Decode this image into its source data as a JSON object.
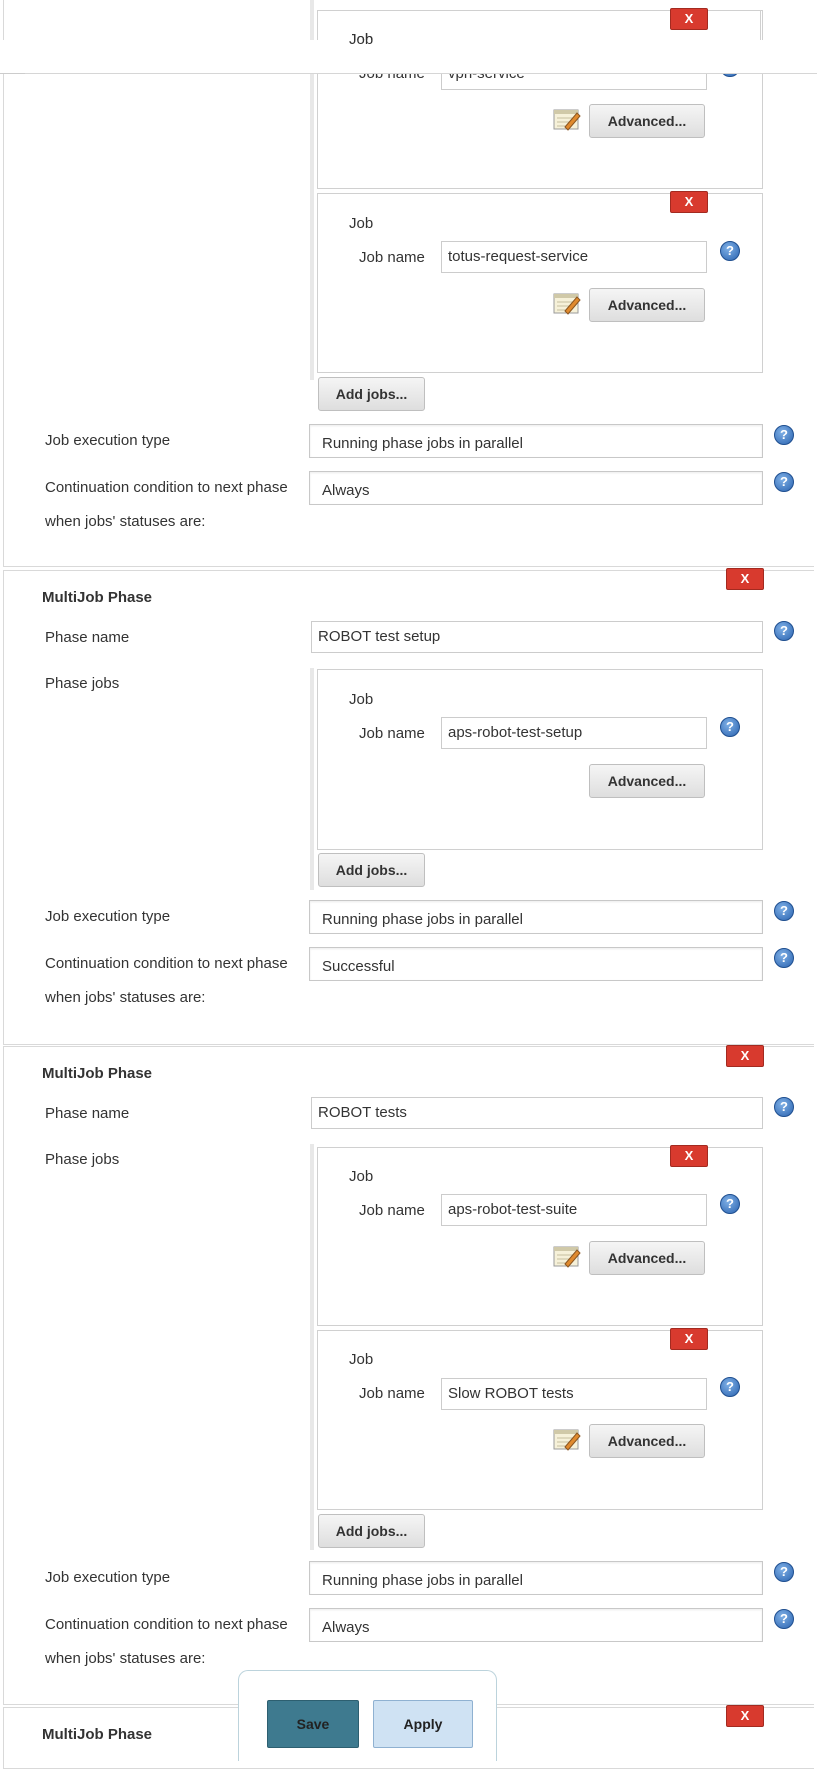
{
  "labels": {
    "job": "Job",
    "job_name": "Job name",
    "multijob_phase": "MultiJob Phase",
    "phase_name": "Phase name",
    "phase_jobs": "Phase jobs",
    "job_execution_type": "Job execution type",
    "continuation_line1": "Continuation condition to next phase",
    "continuation_line2": "when jobs' statuses are:",
    "advanced": "Advanced...",
    "add_jobs": "Add jobs...",
    "delete": "X",
    "help": "?"
  },
  "phase_top": {
    "jobs": [
      {
        "name": "vpn-service"
      },
      {
        "name": "totus-request-service"
      }
    ],
    "execution_type": "Running phase jobs in parallel",
    "continuation": "Always"
  },
  "phase_robot_setup": {
    "name": "ROBOT test setup",
    "jobs": [
      {
        "name": "aps-robot-test-setup"
      }
    ],
    "execution_type": "Running phase jobs in parallel",
    "continuation": "Successful"
  },
  "phase_robot_tests": {
    "name": "ROBOT tests",
    "jobs": [
      {
        "name": "aps-robot-test-suite"
      },
      {
        "name": "Slow ROBOT tests"
      }
    ],
    "execution_type": "Running phase jobs in parallel",
    "continuation": "Always"
  },
  "bottom_bar": {
    "save": "Save",
    "apply": "Apply"
  },
  "colors": {
    "delete_red": "#d83a2e",
    "save_blue": "#3e7a8f",
    "apply_light": "#cfe2f3",
    "help_blue": "#2a63b0"
  }
}
